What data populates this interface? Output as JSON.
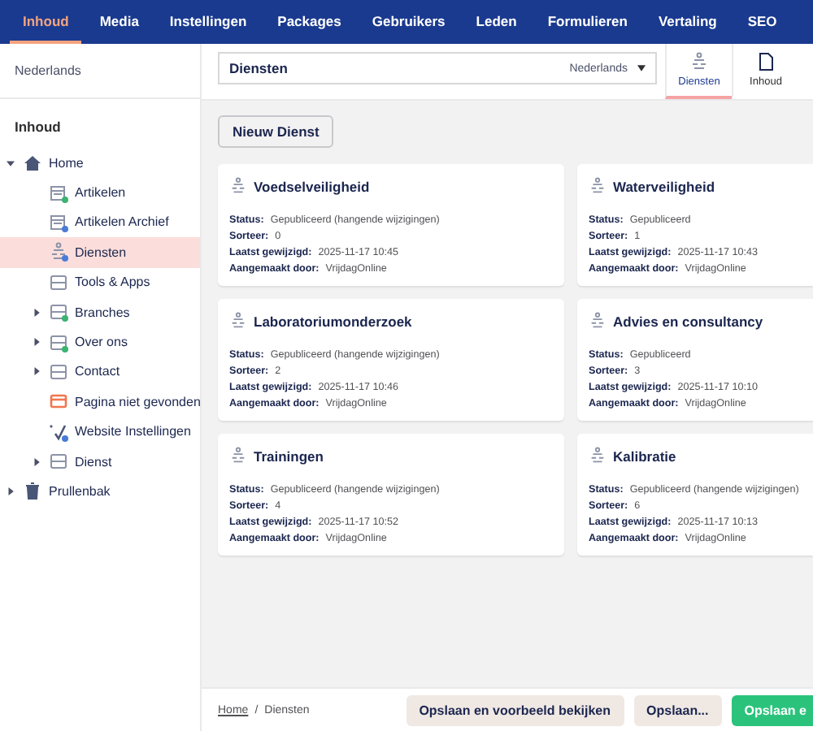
{
  "top_nav": [
    {
      "label": "Inhoud",
      "selected": true
    },
    {
      "label": "Media",
      "selected": false
    },
    {
      "label": "Instellingen",
      "selected": false
    },
    {
      "label": "Packages",
      "selected": false
    },
    {
      "label": "Gebruikers",
      "selected": false
    },
    {
      "label": "Leden",
      "selected": false
    },
    {
      "label": "Formulieren",
      "selected": false
    },
    {
      "label": "Vertaling",
      "selected": false
    },
    {
      "label": "SEO",
      "selected": false
    }
  ],
  "sidebar": {
    "language": "Nederlands",
    "section_title": "Inhoud",
    "tree": [
      {
        "label": "Home",
        "kind": "home",
        "expanded": true,
        "selected": false,
        "children": [
          {
            "label": "Artikelen",
            "kind": "list",
            "color": "#3cb371",
            "selected": false
          },
          {
            "label": "Artikelen Archief",
            "kind": "list",
            "color": "#4a7bd6",
            "selected": false
          },
          {
            "label": "Diensten",
            "kind": "services",
            "color": "#4a7bd6",
            "selected": true
          },
          {
            "label": "Tools & Apps",
            "kind": "page",
            "selected": false
          },
          {
            "label": "Branches",
            "kind": "page",
            "color": "#3cb371",
            "expanded": false,
            "selected": false
          },
          {
            "label": "Over ons",
            "kind": "page",
            "color": "#3cb371",
            "expanded": false,
            "selected": false
          },
          {
            "label": "Contact",
            "kind": "page",
            "expanded": false,
            "selected": false
          },
          {
            "label": "Pagina niet gevonden",
            "kind": "error",
            "selected": false
          },
          {
            "label": "Website Instellingen",
            "kind": "settings",
            "color": "#4a7bd6",
            "selected": false
          },
          {
            "label": "Dienst",
            "kind": "page",
            "expanded": false,
            "selected": false
          }
        ]
      },
      {
        "label": "Prullenbak",
        "kind": "trash",
        "expanded": false,
        "selected": false
      }
    ]
  },
  "header": {
    "name": "Diensten",
    "language": "Nederlands",
    "tabs": [
      {
        "label": "Diensten",
        "kind": "services",
        "selected": true
      },
      {
        "label": "Inhoud",
        "kind": "document",
        "selected": false
      }
    ]
  },
  "new_button": "Nieuw Dienst",
  "cards": [
    {
      "title": "Voedselveiligheid",
      "fields": [
        {
          "label": "Status:",
          "value": "Gepubliceerd (hangende wijzigingen)"
        },
        {
          "label": "Sorteer:",
          "value": "0"
        },
        {
          "label": "Laatst gewijzigd:",
          "value": "2025-11-17 10:45"
        },
        {
          "label": "Aangemaakt door:",
          "value": "VrijdagOnline"
        }
      ]
    },
    {
      "title": "Waterveiligheid",
      "fields": [
        {
          "label": "Status:",
          "value": "Gepubliceerd"
        },
        {
          "label": "Sorteer:",
          "value": "1"
        },
        {
          "label": "Laatst gewijzigd:",
          "value": "2025-11-17 10:43"
        },
        {
          "label": "Aangemaakt door:",
          "value": "VrijdagOnline"
        }
      ]
    },
    {
      "title": "Laboratoriumonderzoek",
      "fields": [
        {
          "label": "Status:",
          "value": "Gepubliceerd (hangende wijzigingen)"
        },
        {
          "label": "Sorteer:",
          "value": "2"
        },
        {
          "label": "Laatst gewijzigd:",
          "value": "2025-11-17 10:46"
        },
        {
          "label": "Aangemaakt door:",
          "value": "VrijdagOnline"
        }
      ]
    },
    {
      "title": "Advies en consultancy",
      "fields": [
        {
          "label": "Status:",
          "value": "Gepubliceerd"
        },
        {
          "label": "Sorteer:",
          "value": "3"
        },
        {
          "label": "Laatst gewijzigd:",
          "value": "2025-11-17 10:10"
        },
        {
          "label": "Aangemaakt door:",
          "value": "VrijdagOnline"
        }
      ]
    },
    {
      "title": "Trainingen",
      "fields": [
        {
          "label": "Status:",
          "value": "Gepubliceerd (hangende wijzigingen)"
        },
        {
          "label": "Sorteer:",
          "value": "4"
        },
        {
          "label": "Laatst gewijzigd:",
          "value": "2025-11-17 10:52"
        },
        {
          "label": "Aangemaakt door:",
          "value": "VrijdagOnline"
        }
      ]
    },
    {
      "title": "Kalibratie",
      "fields": [
        {
          "label": "Status:",
          "value": "Gepubliceerd (hangende wijzigingen)"
        },
        {
          "label": "Sorteer:",
          "value": "6"
        },
        {
          "label": "Laatst gewijzigd:",
          "value": "2025-11-17 10:13"
        },
        {
          "label": "Aangemaakt door:",
          "value": "VrijdagOnline"
        }
      ]
    }
  ],
  "footer": {
    "separator": "/",
    "breadcrumb": [
      {
        "label": "Home",
        "kind": "link"
      },
      {
        "label": "Diensten",
        "kind": "current"
      }
    ],
    "buttons": [
      {
        "label": "Opslaan en voorbeeld bekijken",
        "kind": "secondary"
      },
      {
        "label": "Opslaan...",
        "kind": "secondary"
      },
      {
        "label": "Opslaan e",
        "kind": "primary"
      }
    ]
  }
}
